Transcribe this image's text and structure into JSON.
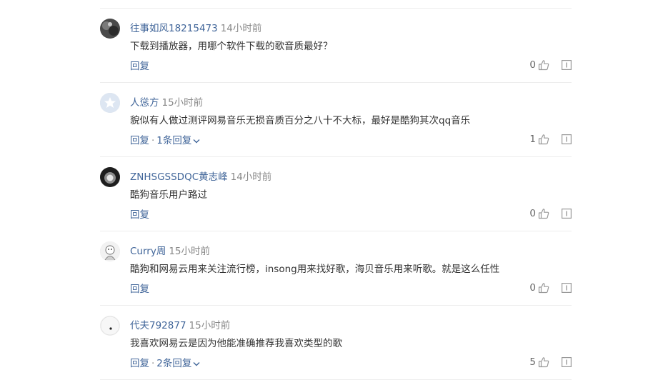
{
  "comments": [
    {
      "avatar_icon": "dark-photo-avatar",
      "user": "往事如风18215473",
      "time": "14小时前",
      "text": "下载到播放器，用哪个软件下载的歌音质最好？",
      "reply_label": "回复",
      "replies_label": "",
      "likes": "0"
    },
    {
      "avatar_icon": "default-star-avatar",
      "user": "人慫方",
      "time": "15小时前",
      "text": "貌似有人做过测评网易音乐无损音质百分之八十不大标，最好是酷狗其次qq音乐",
      "reply_label": "回复",
      "replies_label": "1条回复",
      "likes": "1"
    },
    {
      "avatar_icon": "dark-photo-avatar",
      "user": "ZNHSGSSDQC黄志峰",
      "time": "14小时前",
      "text": "酷狗音乐用户路过",
      "reply_label": "回复",
      "replies_label": "",
      "likes": "0"
    },
    {
      "avatar_icon": "cartoon-avatar",
      "user": "Curry周",
      "time": "15小时前",
      "text": "酷狗和网易云用来关注流行榜，insong用来找好歌，海贝音乐用来听歌。就是这么任性",
      "reply_label": "回复",
      "replies_label": "",
      "likes": "0"
    },
    {
      "avatar_icon": "light-photo-avatar",
      "user": "代夫792877",
      "time": "15小时前",
      "text": "我喜欢网易云是因为他能准确推荐我喜欢类型的歌",
      "reply_label": "回复",
      "replies_label": "2条回复",
      "likes": "5"
    }
  ],
  "colors": {
    "link": "#406599",
    "meta": "#888888",
    "icon": "#999999",
    "divider": "#ededed"
  }
}
